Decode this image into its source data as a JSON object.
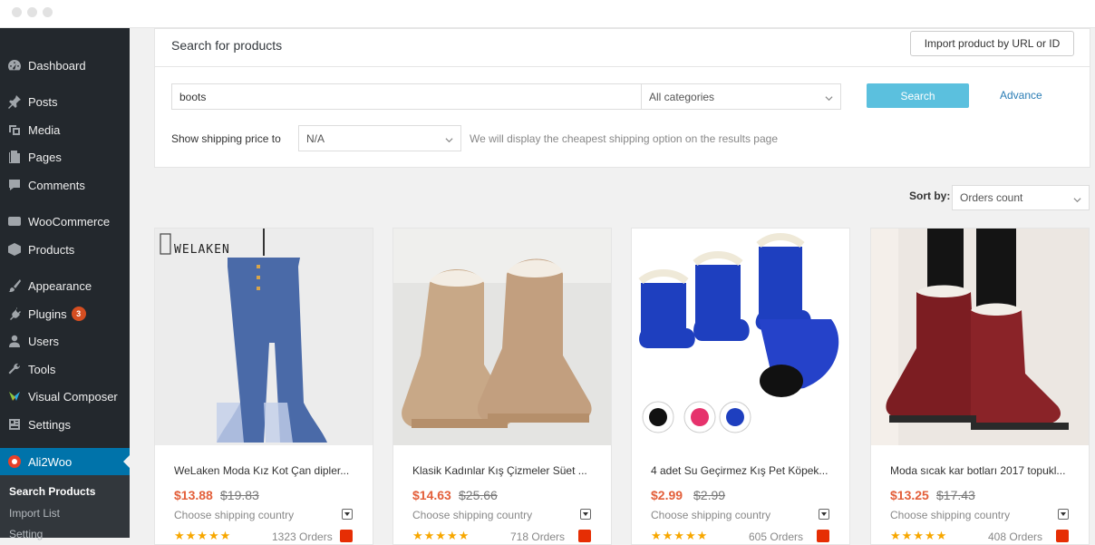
{
  "sidebar": {
    "items": [
      {
        "label": "Dashboard",
        "icon": "dashboard-icon"
      },
      {
        "label": "Posts",
        "icon": "pin-icon"
      },
      {
        "label": "Media",
        "icon": "media-icon"
      },
      {
        "label": "Pages",
        "icon": "pages-icon"
      },
      {
        "label": "Comments",
        "icon": "comment-icon"
      },
      {
        "label": "WooCommerce",
        "icon": "woo-icon"
      },
      {
        "label": "Products",
        "icon": "box-icon"
      },
      {
        "label": "Appearance",
        "icon": "brush-icon"
      },
      {
        "label": "Plugins",
        "icon": "plugin-icon",
        "badge": "3"
      },
      {
        "label": "Users",
        "icon": "user-icon"
      },
      {
        "label": "Tools",
        "icon": "wrench-icon"
      },
      {
        "label": "Visual Composer",
        "icon": "vc-icon"
      },
      {
        "label": "Settings",
        "icon": "settings-icon"
      },
      {
        "label": "Ali2Woo",
        "icon": "ali2woo-icon",
        "active": true
      }
    ],
    "submenu": [
      "Search Products",
      "Import List",
      "Setting"
    ]
  },
  "search_panel": {
    "title": "Search for products",
    "import_button": "Import product by URL or ID",
    "query": "boots",
    "category": "All categories",
    "search_button": "Search",
    "advance_link": "Advance",
    "shipping_label": "Show shipping price to",
    "shipping_value": "N/A",
    "shipping_note": "We will display the cheapest shipping option on the results page"
  },
  "sort": {
    "label": "Sort by:",
    "value": "Orders count"
  },
  "products": [
    {
      "title": "WeLaken Moda Kız Kot Çan dipler...",
      "price": "$13.88",
      "old_price": "$19.83",
      "shipping": "Choose shipping country",
      "stars": "★★★★★",
      "orders": "1323 Orders",
      "brand": "WELAKEN"
    },
    {
      "title": "Klasik Kadınlar Kış Çizmeler Süet ...",
      "price": "$14.63",
      "old_price": "$25.66",
      "shipping": "Choose shipping country",
      "stars": "★★★★★",
      "orders": "718 Orders"
    },
    {
      "title": "4 adet Su Geçirmez Kış Pet Köpek...",
      "price": "$2.99",
      "old_price": "$2.99",
      "shipping": "Choose shipping country",
      "stars": "★★★★★",
      "orders": "605 Orders"
    },
    {
      "title": "Moda sıcak kar botları 2017 topukl...",
      "price": "$13.25",
      "old_price": "$17.43",
      "shipping": "Choose shipping country",
      "stars": "★★★★★",
      "orders": "408 Orders"
    }
  ],
  "colors": {
    "sidebar_bg": "#23282d",
    "active": "#0073aa",
    "price": "#e35f3a",
    "search_btn": "#5bc0de"
  }
}
